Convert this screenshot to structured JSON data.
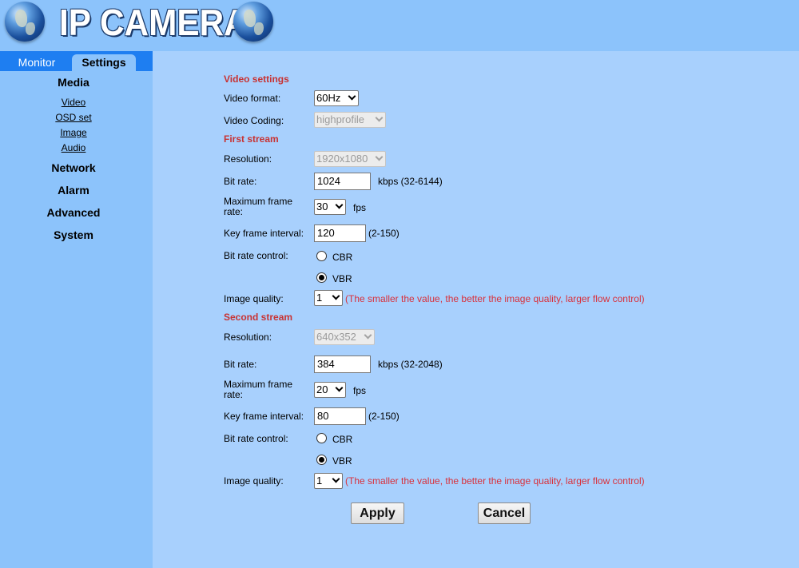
{
  "header": {
    "title": "IP CAMERA"
  },
  "tabs": {
    "monitor": "Monitor",
    "settings": "Settings"
  },
  "sidebar": {
    "media": "Media",
    "media_items": [
      "Video",
      "OSD set",
      "Image",
      "Audio"
    ],
    "network": "Network",
    "alarm": "Alarm",
    "advanced": "Advanced",
    "system": "System"
  },
  "video": {
    "section_title": "Video settings",
    "format_label": "Video format:",
    "format_value": "60Hz",
    "coding_label": "Video Coding:",
    "coding_value": "highprofile"
  },
  "first_stream": {
    "title": "First stream",
    "resolution_label": "Resolution:",
    "resolution_value": "1920x1080",
    "bitrate_label": "Bit rate:",
    "bitrate_value": "1024",
    "bitrate_range": "kbps (32-6144)",
    "max_frame_label_1": "Maximum frame",
    "max_frame_label_2": "rate:",
    "max_frame_value": "30",
    "fps": "fps",
    "keyframe_label": "Key frame interval:",
    "keyframe_value": "120",
    "keyframe_range": "(2-150)",
    "bitrate_control_label": "Bit rate control:",
    "cbr": "CBR",
    "vbr": "VBR",
    "selected_control": "VBR",
    "quality_label": "Image quality:",
    "quality_value": "1",
    "quality_hint": "(The smaller the value, the better the image quality, larger flow control)"
  },
  "second_stream": {
    "title": "Second stream",
    "resolution_label": "Resolution:",
    "resolution_value": "640x352",
    "bitrate_label": "Bit rate:",
    "bitrate_value": "384",
    "bitrate_range": "kbps (32-2048)",
    "max_frame_label_1": "Maximum frame",
    "max_frame_label_2": "rate:",
    "max_frame_value": "20",
    "fps": "fps",
    "keyframe_label": "Key frame interval:",
    "keyframe_value": "80",
    "keyframe_range": "(2-150)",
    "bitrate_control_label": "Bit rate control:",
    "cbr": "CBR",
    "vbr": "VBR",
    "selected_control": "VBR",
    "quality_label": "Image quality:",
    "quality_value": "1",
    "quality_hint": "(The smaller the value, the better the image quality, larger flow control)"
  },
  "buttons": {
    "apply": "Apply",
    "cancel": "Cancel"
  }
}
